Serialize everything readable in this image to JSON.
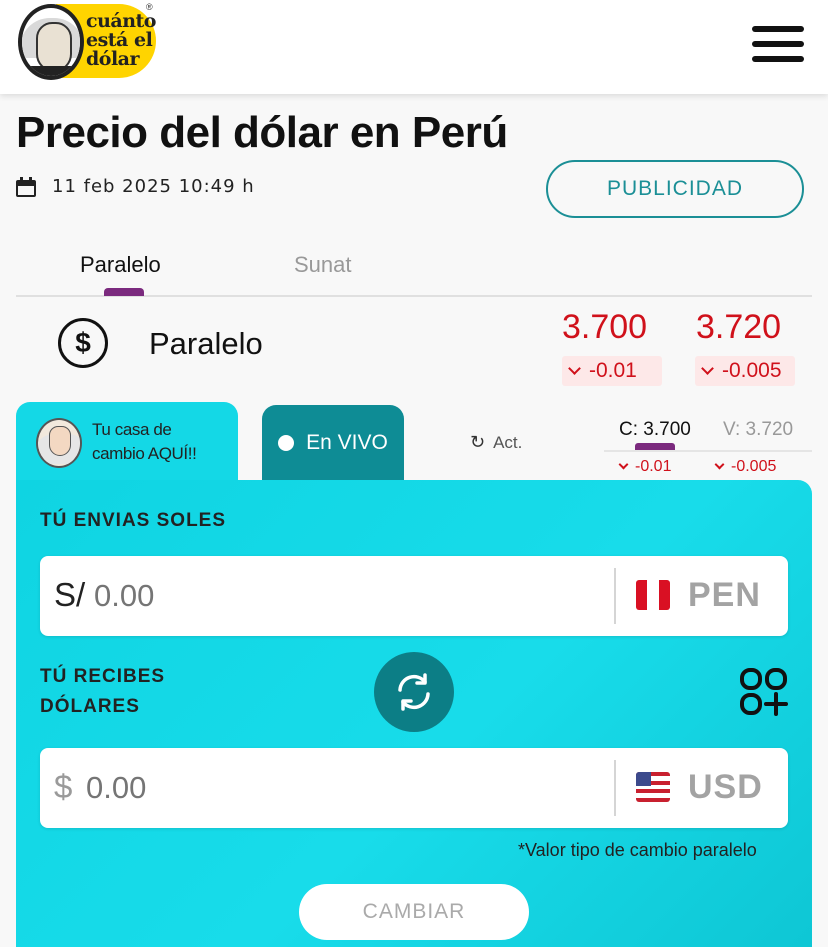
{
  "header": {
    "logo_text": [
      "cuánto",
      "está el",
      "dólar"
    ],
    "logo_reg": "®",
    "menu_icon": "hamburger-menu-icon"
  },
  "page": {
    "title": "Precio del dólar en Perú",
    "date": "11 feb 2025 10:49 h",
    "publicidad_label": "PUBLICIDAD"
  },
  "tabs": [
    {
      "label": "Paralelo",
      "active": true
    },
    {
      "label": "Sunat",
      "active": false
    }
  ],
  "paralelo": {
    "label": "Paralelo",
    "buy": "3.700",
    "sell": "3.720",
    "buy_change": "-0.01",
    "sell_change": "-0.005"
  },
  "converter": {
    "promo_line1": "Tu casa de",
    "promo_line2": "cambio AQUÍ!!",
    "live_label": "En VIVO",
    "act_label": "Act.",
    "mini_buy": "C: 3.700",
    "mini_sell": "V: 3.720",
    "mini_buy_change": "-0.01",
    "mini_sell_change": "-0.005",
    "send_label": "TÚ ENVIAS SOLES",
    "send_prefix": "S/",
    "send_placeholder": "0.00",
    "send_currency": "PEN",
    "recv_label_line1": "TÚ RECIBES",
    "recv_label_line2": "DÓLARES",
    "recv_prefix": "$",
    "recv_placeholder": "0.00",
    "recv_currency": "USD",
    "note": "*Valor tipo de cambio paralelo",
    "cambiar_label": "CAMBIAR"
  },
  "colors": {
    "accent_teal": "#1b8f96",
    "card_cyan": "#14d8e6",
    "live_tab": "#0e8c95",
    "down_red": "#d0111b",
    "tab_indicator": "#7b2a7e",
    "logo_yellow": "#ffd400"
  }
}
